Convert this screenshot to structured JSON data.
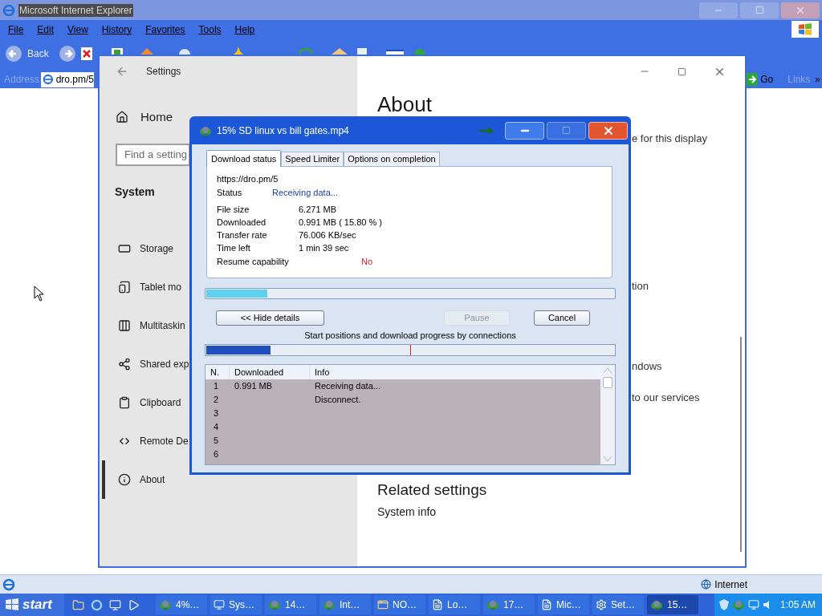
{
  "browser": {
    "title": "Microsoft Internet Explorer",
    "menu": [
      "File",
      "Edit",
      "View",
      "History",
      "Favorites",
      "Tools",
      "Help"
    ],
    "back": "Back",
    "address_label": "Address",
    "address": "dro.pm/5",
    "go": "Go",
    "links": "Links",
    "more": "»",
    "status_zone": "Internet"
  },
  "settings": {
    "title": "Settings",
    "home": "Home",
    "search": {
      "placeholder": "Find a setting"
    },
    "section": "System",
    "items": [
      {
        "label": "Storage",
        "kind": "storage",
        "selected": false
      },
      {
        "label": "Tablet mo",
        "kind": "tablet",
        "selected": false
      },
      {
        "label": "Multitaskin",
        "kind": "multitask",
        "selected": false
      },
      {
        "label": "Shared exp",
        "kind": "shared",
        "selected": false
      },
      {
        "label": "Clipboard",
        "kind": "clipboard",
        "selected": false
      },
      {
        "label": "Remote De",
        "kind": "remote",
        "selected": false
      },
      {
        "label": "About",
        "kind": "info",
        "selected": true
      }
    ],
    "heading": "About",
    "fragments": [
      "e for this display",
      "tion",
      "ndows",
      "to our services"
    ],
    "related": "Related settings",
    "links": [
      "System info"
    ]
  },
  "download": {
    "title": "15% SD linux vs bill gates.mp4",
    "tabs": [
      {
        "label": "Download status",
        "selected": true
      },
      {
        "label": "Speed Limiter",
        "selected": false
      },
      {
        "label": "Options on completion",
        "selected": false
      }
    ],
    "url": "https://dro.pm/5",
    "status_label": "Status",
    "status_value": "Receiving data...",
    "details": [
      {
        "label": "File size",
        "value": "6.271 MB"
      },
      {
        "label": "Downloaded",
        "value": "0.991 MB ( 15.80 % )"
      },
      {
        "label": "Transfer rate",
        "value": "76.006 KB/sec"
      },
      {
        "label": "Time left",
        "value": "1 min 39 sec"
      }
    ],
    "resume": {
      "label": "Resume capability",
      "value": "No"
    },
    "progress": {
      "level": 0.15
    },
    "buttons": [
      {
        "label": "<< Hide details",
        "disabled": false
      },
      {
        "label": "Pause",
        "disabled": true
      },
      {
        "label": "Cancel",
        "disabled": false
      }
    ],
    "connections_label": "Start positions and download progress by connections",
    "connections": {
      "level": 0.157
    },
    "table": {
      "columns": [
        "N.",
        "Downloaded",
        "Info"
      ],
      "rows": [
        {
          "n": "1",
          "downloaded": "0.991 MB",
          "info": "Receiving data..."
        },
        {
          "n": "2",
          "info": "Disconnect."
        },
        {
          "n": "3"
        },
        {
          "n": "4"
        },
        {
          "n": "5"
        },
        {
          "n": "6"
        }
      ]
    }
  },
  "taskbar": {
    "start": "start",
    "tasks": [
      {
        "label": "4%…",
        "kind": "download",
        "selected": false
      },
      {
        "label": "Sys…",
        "kind": "system",
        "selected": false
      },
      {
        "label": "14…",
        "kind": "download",
        "selected": false
      },
      {
        "label": "Int…",
        "kind": "download",
        "selected": false
      },
      {
        "label": "NO…",
        "kind": "app",
        "selected": false
      },
      {
        "label": "Lo…",
        "kind": "doc",
        "selected": false
      },
      {
        "label": "17…",
        "kind": "download",
        "selected": false
      },
      {
        "label": "Mic…",
        "kind": "doc",
        "selected": false
      },
      {
        "label": "Set…",
        "kind": "settings",
        "selected": false
      },
      {
        "label": "15…",
        "kind": "download",
        "selected": true
      }
    ],
    "clock": "1:05 AM"
  }
}
